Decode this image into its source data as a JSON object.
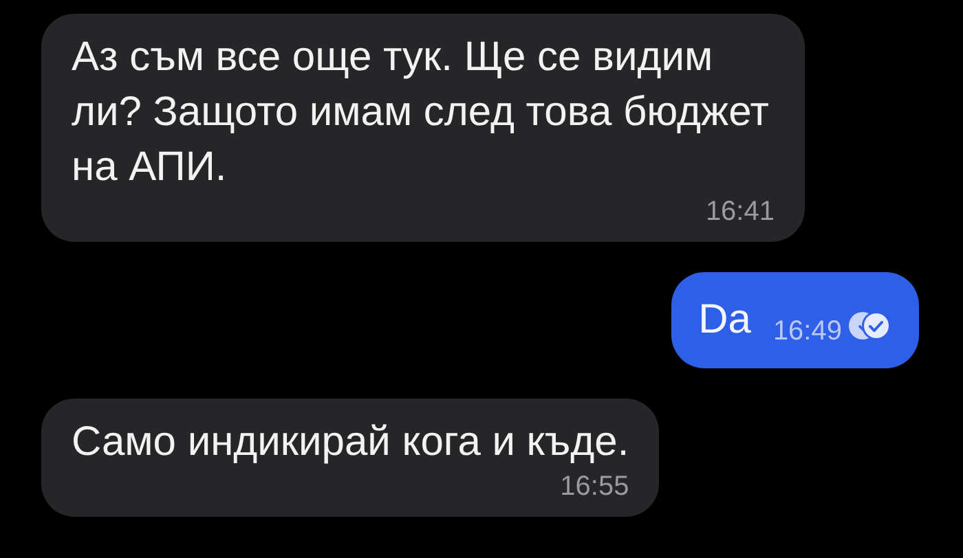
{
  "messages": [
    {
      "kind": "incoming",
      "text": "Аз съм все още тук. Ще се видим ли? Защото имам след това бюджет на АПИ.",
      "time": "16:41"
    },
    {
      "kind": "outgoing",
      "text": "Da",
      "time": "16:49",
      "seen": true
    },
    {
      "kind": "incoming",
      "text": "Само индикирай кога и къде.",
      "time": "16:55"
    }
  ]
}
